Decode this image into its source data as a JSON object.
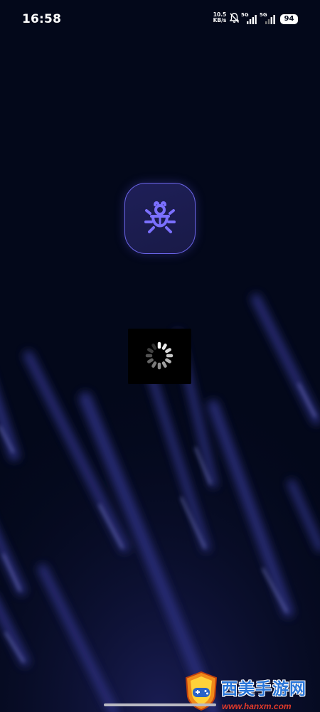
{
  "status_bar": {
    "time": "16:58",
    "net_speed_value": "10.5",
    "net_speed_unit": "KB/s",
    "sim1_gen": "5G",
    "sim2_gen": "5G",
    "battery": "94",
    "icons": [
      "mute-bell-icon",
      "signal-icon",
      "signal-icon",
      "battery-icon"
    ]
  },
  "app": {
    "icon": "bug-icon",
    "accent_color": "#6a64e6"
  },
  "loading": {
    "icon": "spinner-icon"
  },
  "watermark": {
    "title": "西美手游网",
    "url": "www.hanxm.com",
    "icon": "gamepad-shield-icon"
  }
}
